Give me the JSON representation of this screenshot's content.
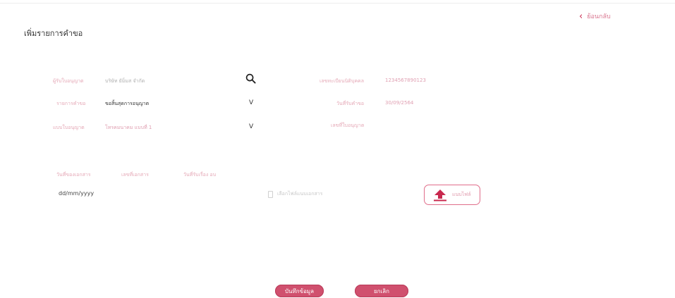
{
  "header": {
    "back_label": "ย้อนกลับ",
    "page_title": "เพิ่มรายการคำขอ"
  },
  "form": {
    "licensee_label": "ผู้รับใบอนุญาต",
    "licensee_value": "บริษัท ยัม็มส จำกัด",
    "reg_no_label": "เลขทะเบียนนิติบุคคล",
    "reg_no_value": "1234567890123",
    "request_list_label": "รายการคำขอ",
    "request_list_value": "ขอสิ้นสุดการอนุญาต",
    "received_date_label": "วันที่รับคำขอ",
    "received_date_value": "30/09/2564",
    "form_type_label": "แบบใบอนุญาต",
    "form_type_value": "โทรคมนาคม แบบที่ 1",
    "license_no_label": "เลขที่ใบอนุญาต",
    "license_no_value": "",
    "dropdown_mark": "V"
  },
  "documents": {
    "tabs": [
      "วันที่ของเอกสาร",
      "เลขที่เอกสาร",
      "วันที่รับเรื่อง อบ"
    ],
    "date_value": "dd/mm/yyyy",
    "file_hint": "เลือกไฟล์แนบเอกสาร",
    "upload_label": "แนบไฟล์"
  },
  "actions": {
    "save_label": "บันทึกข้อมูล",
    "cancel_label": "ยกเลิก"
  },
  "colors": {
    "accent": "#d0506e",
    "accent_dark": "#c8284e",
    "label_pink": "#e5a9b7"
  },
  "icons": {
    "search": "search-icon",
    "back": "chevron-left-icon",
    "upload": "upload-icon",
    "file": "file-icon"
  }
}
